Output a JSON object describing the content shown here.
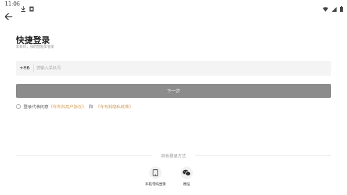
{
  "status_bar": {
    "time": "11:06",
    "icons": [
      "download-icon",
      "notification-icon",
      "wifi-icon",
      "signal-icon",
      "battery-icon"
    ]
  },
  "header": {
    "back_icon": "arrow-left-icon"
  },
  "main": {
    "title": "快捷登录",
    "subtitle": "车有料，我的智能车管家",
    "phone": {
      "country_code": "+86",
      "placeholder": "请输入手机号",
      "value": ""
    },
    "next_button_label": "下一步",
    "agreement": {
      "prefix": "登录代表同意",
      "user_agreement": "《车有料用户协议》",
      "conjunction": "和",
      "privacy_policy": "《车有料隐私政策》",
      "checked": false
    },
    "other_login": {
      "title": "其他登录方式",
      "options": [
        {
          "label": "本机号码登录",
          "icon": "mobile-phone-icon"
        },
        {
          "label": "微信",
          "icon": "wechat-icon"
        }
      ]
    }
  },
  "colors": {
    "button_bg": "#8c8c8c",
    "link": "#d49a52",
    "input_bg": "#f4f4f4"
  }
}
